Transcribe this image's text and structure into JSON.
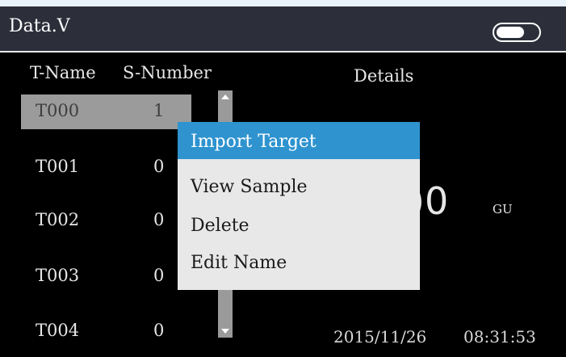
{
  "title_bar": {
    "title": "Data.V",
    "battery_icon": "battery-icon"
  },
  "columns": {
    "t_name": "T-Name",
    "s_number": "S-Number",
    "details": "Details"
  },
  "rows": [
    {
      "name": "T000",
      "number": "1",
      "selected": true
    },
    {
      "name": "T001",
      "number": "0"
    },
    {
      "name": "T002",
      "number": "0"
    },
    {
      "name": "T003",
      "number": "0"
    },
    {
      "name": "T004",
      "number": "0"
    }
  ],
  "details": {
    "value": ")0",
    "unit": "GU"
  },
  "status": {
    "date": "2015/11/26",
    "time": "08:31:53"
  },
  "context_menu": {
    "items": [
      {
        "label": "Import Target",
        "active": true
      },
      {
        "label": "View Sample"
      },
      {
        "label": "Delete"
      },
      {
        "label": "Edit Name"
      }
    ]
  },
  "colors": {
    "highlight": "#2e93cf",
    "selected_row": "#9b9b9b",
    "title_bar": "#2c2f3a"
  }
}
